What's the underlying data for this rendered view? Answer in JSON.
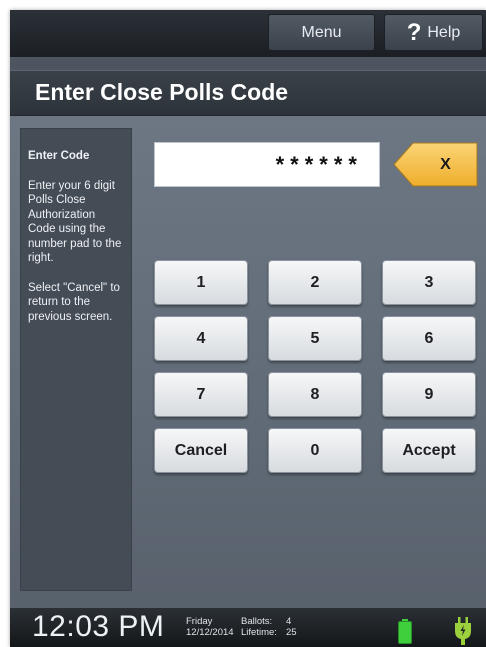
{
  "topbar": {
    "menu_label": "Menu",
    "help_label": "Help",
    "help_icon": "?"
  },
  "title": "Enter Close Polls Code",
  "instructions": {
    "heading": "Enter Code",
    "paragraph1": "Enter your 6 digit Polls Close Authorization Code using the number pad to the right.",
    "paragraph2": "Select \"Cancel\" to return to the previous screen."
  },
  "code": {
    "masked_value": "******",
    "clear_label": "X"
  },
  "keypad": {
    "k1": "1",
    "k2": "2",
    "k3": "3",
    "k4": "4",
    "k5": "5",
    "k6": "6",
    "k7": "7",
    "k8": "8",
    "k9": "9",
    "cancel": "Cancel",
    "k0": "0",
    "accept": "Accept"
  },
  "status": {
    "time": "12:03 PM",
    "day": "Friday",
    "date": "12/12/2014",
    "ballots_label": "Ballots:",
    "ballots_value": "4",
    "lifetime_label": "Lifetime:",
    "lifetime_value": "25"
  },
  "colors": {
    "accent_clear": "#f7c24e",
    "battery": "#3fcf3c",
    "plug": "#9ccf3c"
  },
  "icons": {
    "help": "question-icon",
    "clear": "backspace-icon",
    "battery": "battery-icon",
    "power": "power-plug-icon"
  }
}
